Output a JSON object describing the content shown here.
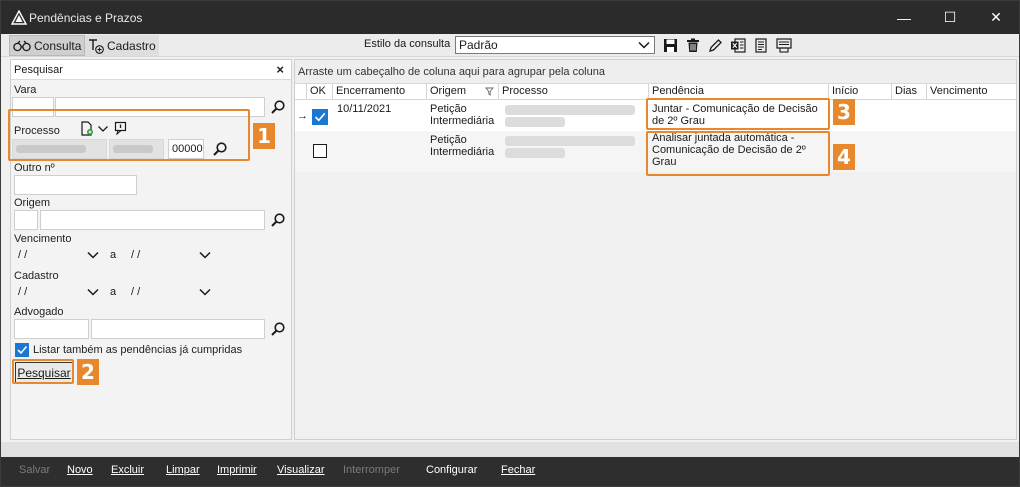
{
  "window": {
    "title": "Pendências e Prazos",
    "controls": {
      "minimize": "—",
      "maximize": "☐",
      "close": "✕"
    }
  },
  "toolbar": {
    "tabs": [
      {
        "label": "Consulta",
        "icon": "binoculars-icon"
      },
      {
        "label": "Cadastro",
        "icon": "text-add-icon"
      }
    ],
    "style_label": "Estilo da consulta",
    "style_value": "Padrão",
    "icons": [
      "save-icon",
      "trash-icon",
      "edit-pencil-icon",
      "excel-export-icon",
      "document-icon",
      "print-preview-icon"
    ]
  },
  "search_panel": {
    "title": "Pesquisar",
    "close": "×",
    "vara_label": "Vara",
    "processo_label": "Processo",
    "processo_suffix": "00000",
    "outro_label": "Outro nº",
    "origem_label": "Origem",
    "vencimento_label": "Vencimento",
    "cadastro_label": "Cadastro",
    "date_placeholder": " / /",
    "a_sep": "a",
    "advogado_label": "Advogado",
    "listar_label": "Listar também as pendências já cumpridas",
    "listar_checked": true,
    "pesquisar_button": "Pesquisar"
  },
  "grid": {
    "group_hint": "Arraste um cabeçalho de coluna aqui para agrupar pela coluna",
    "columns": [
      "OK",
      "Encerramento",
      "Origem",
      "Processo",
      "Pendência",
      "Início",
      "Dias",
      "Vencimento"
    ],
    "rows": [
      {
        "ok": true,
        "encerramento": "10/11/2021",
        "origem": [
          "Petição",
          "Intermediária"
        ],
        "pendencia": [
          "Juntar - Comunicação de Decisão",
          "de 2º Grau"
        ]
      },
      {
        "ok": false,
        "encerramento": "",
        "origem": [
          "Petição",
          "Intermediária"
        ],
        "pendencia": [
          "Analisar juntada automática -",
          "Comunicação de Decisão de 2º",
          "Grau"
        ]
      }
    ],
    "row_indicator": "→"
  },
  "annotations": [
    "1",
    "2",
    "3",
    "4"
  ],
  "footer": {
    "commands": [
      {
        "label": "Salvar",
        "enabled": false
      },
      {
        "label": "Novo",
        "enabled": true
      },
      {
        "label": "Excluir",
        "enabled": true
      },
      {
        "label": "Limpar",
        "enabled": true
      },
      {
        "label": "Imprimir",
        "enabled": true
      },
      {
        "label": "Visualizar",
        "enabled": true
      },
      {
        "label": "Interromper",
        "enabled": false
      },
      {
        "label": "Configurar",
        "enabled": true
      },
      {
        "label": "Fechar",
        "enabled": true
      }
    ]
  },
  "colors": {
    "titlebar": "#2b2b2b",
    "accent_annotation": "#e8882c",
    "checkbox_blue": "#1976d2",
    "footer": "#2e2e2e"
  }
}
